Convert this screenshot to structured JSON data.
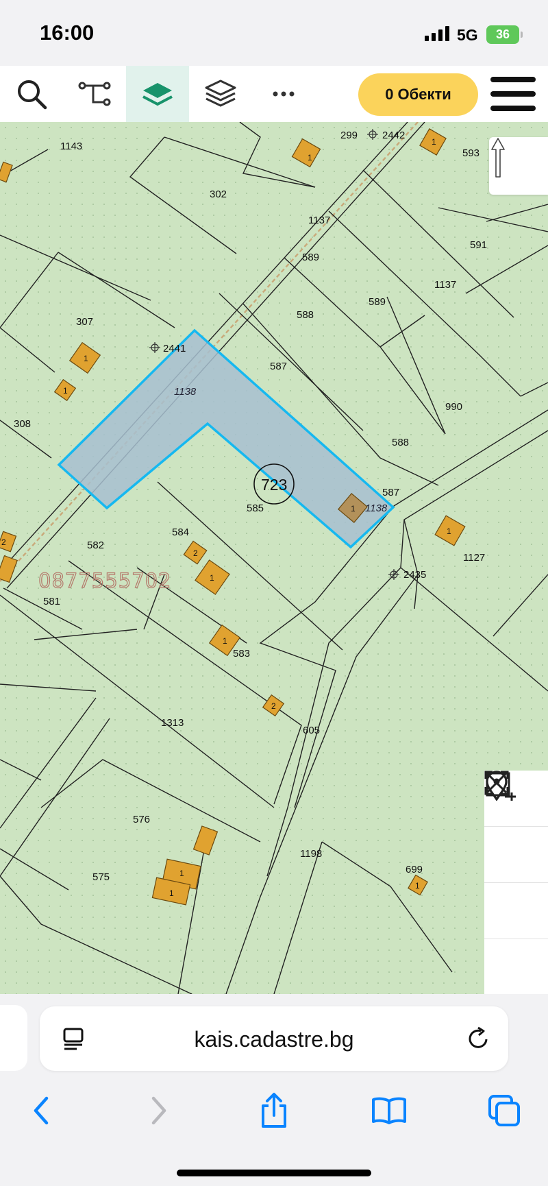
{
  "status_bar": {
    "time": "16:00",
    "network": "5G",
    "battery": "36"
  },
  "toolbar": {
    "icons": [
      "search-icon",
      "route-icon",
      "layer-active-icon",
      "layers-icon",
      "more-icon"
    ],
    "objects_label": "0 Обекти",
    "accent": "#fbd35b",
    "active_tab_color": "#e1f2ec",
    "brand_green": "#18936b"
  },
  "map": {
    "background": "#cde4c1",
    "highlight_fill": "#a7bfd0",
    "highlight_stroke": "#16b8f0",
    "building_fill": "#e0a230",
    "region_number": "723",
    "phone_watermark": "0877555702",
    "parcels": [
      "299",
      "2442",
      "593",
      "1143",
      "302",
      "1137",
      "591",
      "589",
      "1137",
      "307",
      "589",
      "588",
      "2441",
      "1138",
      "587",
      "990",
      "308",
      "588",
      "587",
      "723",
      "585",
      "1138",
      "584",
      "582",
      "1127",
      "2435",
      "581",
      "583",
      "1313",
      "605",
      "576",
      "1198",
      "575",
      "699"
    ],
    "building_numbers": [
      "1",
      "1",
      "1",
      "1",
      "1",
      "1",
      "2",
      "1",
      "1",
      "2",
      "2",
      "1",
      "1",
      "1"
    ],
    "controls": [
      "compass-icon",
      "location-pin-icon",
      "add-area-icon",
      "remove-area-icon",
      "fullscreen-icon"
    ]
  },
  "browser": {
    "url": "kais.cadastre.bg",
    "icons": [
      "reader-icon",
      "reload-icon",
      "back-icon",
      "forward-icon",
      "share-icon",
      "bookmarks-icon",
      "tabs-icon"
    ],
    "link_blue": "#0a84ff"
  }
}
